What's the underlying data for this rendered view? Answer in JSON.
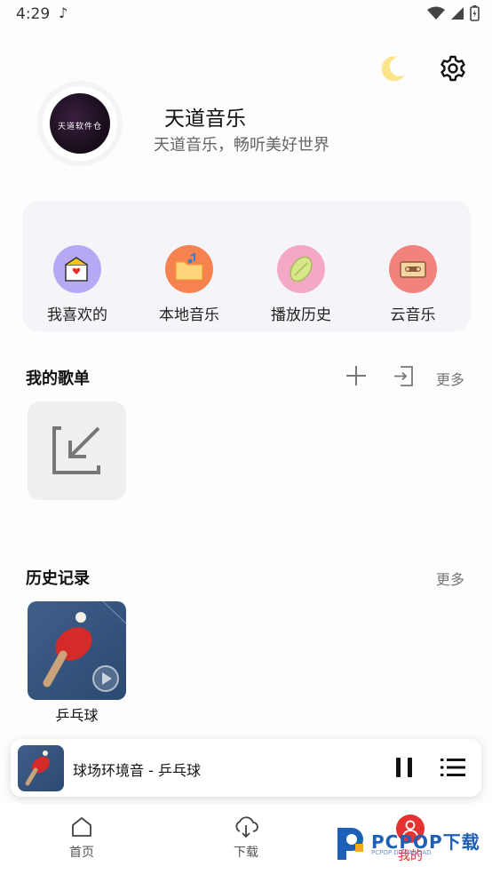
{
  "status_bar": {
    "time": "4:29"
  },
  "profile": {
    "name": "天道音乐",
    "description": "天道音乐，畅听美好世界",
    "avatar_text": "天道软件仓"
  },
  "quick_actions": [
    {
      "label": "我喜欢的",
      "color": "#b6a8f2"
    },
    {
      "label": "本地音乐",
      "color": "#f5824f"
    },
    {
      "label": "播放历史",
      "color": "#f3a9c6"
    },
    {
      "label": "云音乐",
      "color": "#f1827c"
    }
  ],
  "playlists": {
    "title": "我的歌单",
    "more": "更多"
  },
  "history": {
    "title": "历史记录",
    "more": "更多",
    "items": [
      {
        "name": "乒乓球"
      }
    ]
  },
  "now_playing": {
    "title": "球场环境音 - 乒乓球"
  },
  "tabs": [
    {
      "label": "首页",
      "active": false
    },
    {
      "label": "下载",
      "active": false
    },
    {
      "label": "我的",
      "active": true
    }
  ],
  "watermark": {
    "text": "PCPOP下载",
    "sub": "PCPOP DOWNLOAD"
  },
  "accent_color": "#e5312f"
}
